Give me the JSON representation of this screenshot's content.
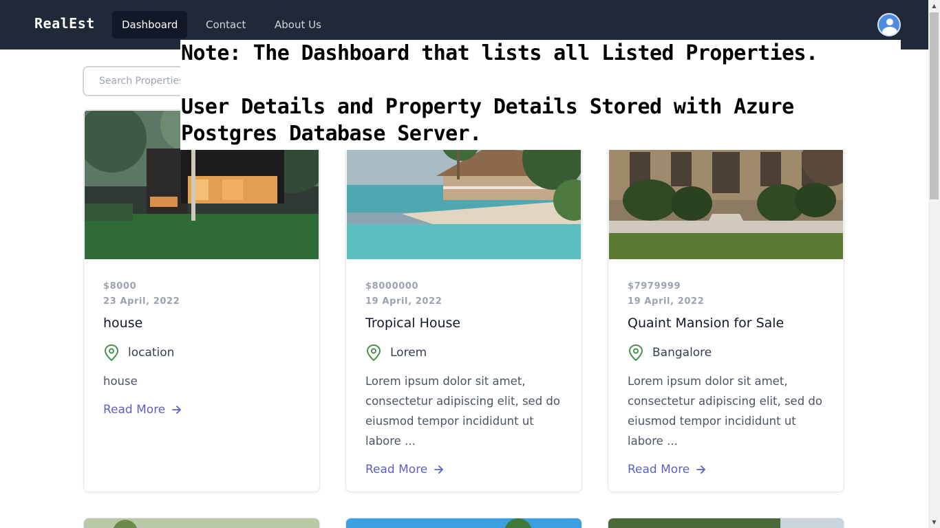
{
  "navbar": {
    "brand": "RealEst",
    "links": [
      "Dashboard",
      "Contact",
      "About Us"
    ]
  },
  "search": {
    "placeholder": "Search Properties"
  },
  "note": {
    "line1": "Note: The Dashboard that lists all Listed Properties.",
    "line2": "User Details and Property Details Stored with Azure Postgres Database Server."
  },
  "cards": [
    {
      "price": "$8000",
      "date": "23 April, 2022",
      "title": "house",
      "location": "location",
      "description": "house",
      "read_more": "Read More"
    },
    {
      "price": "$8000000",
      "date": "19 April, 2022",
      "title": "Tropical House",
      "location": "Lorem",
      "description": "Lorem ipsum dolor sit amet, consectetur adipiscing elit, sed do eiusmod tempor incididunt ut labore ...",
      "read_more": "Read More"
    },
    {
      "price": "$7979999",
      "date": "19 April, 2022",
      "title": "Quaint Mansion for Sale",
      "location": "Bangalore",
      "description": "Lorem ipsum dolor sit amet, consectetur adipiscing elit, sed do eiusmod tempor incididunt ut labore ...",
      "read_more": "Read More"
    }
  ],
  "icons": {
    "location": "map-pin-icon",
    "read_more": "arrow-right-icon",
    "avatar": "user-avatar-icon"
  },
  "colors": {
    "navbar_bg": "#1f2937",
    "link_accent": "#5b5fc7",
    "pin_green": "#4a8f4f"
  }
}
